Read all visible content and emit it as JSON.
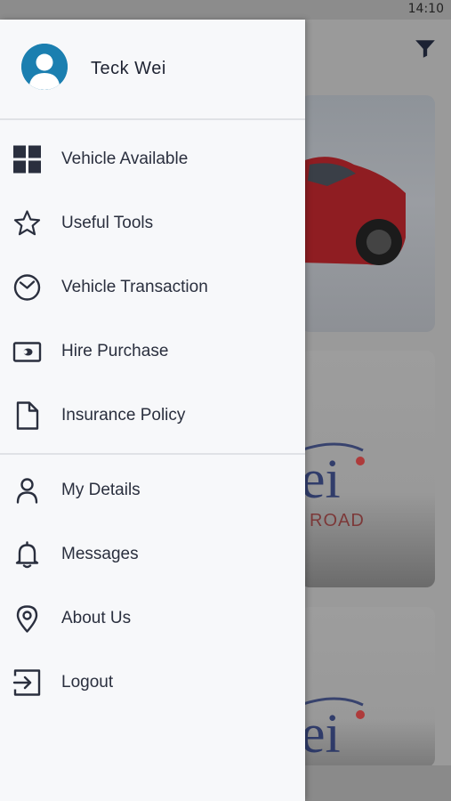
{
  "status_bar": {
    "time": "14:10"
  },
  "drawer": {
    "user_name": "Teck Wei",
    "primary_menu": [
      {
        "label": "Vehicle Available",
        "icon": "grid-icon"
      },
      {
        "label": "Useful Tools",
        "icon": "star-icon"
      },
      {
        "label": "Vehicle Transaction",
        "icon": "clock-icon"
      },
      {
        "label": "Hire Purchase",
        "icon": "money-icon"
      },
      {
        "label": "Insurance Policy",
        "icon": "document-icon"
      }
    ],
    "secondary_menu": [
      {
        "label": "My Details",
        "icon": "user-icon"
      },
      {
        "label": "Messages",
        "icon": "bell-icon"
      },
      {
        "label": "About Us",
        "icon": "location-pin-icon"
      },
      {
        "label": "Logout",
        "icon": "logout-icon"
      }
    ]
  },
  "background": {
    "card2_logo": "ei",
    "card2_logo_sub": "ROAD",
    "card3_logo": "ei"
  },
  "colors": {
    "icon": "#2a2f3e",
    "avatar": "#1b7fb0",
    "drawer_bg": "#f7f8fa"
  }
}
